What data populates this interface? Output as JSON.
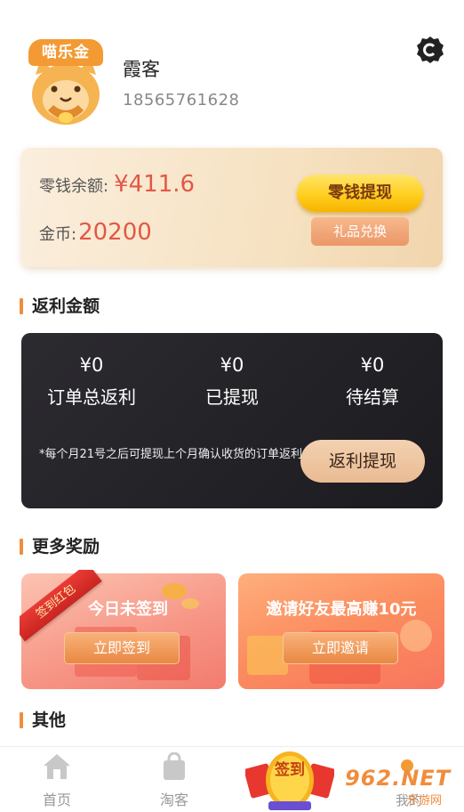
{
  "profile": {
    "avatar_logo_text": "喵乐金",
    "name": "霞客",
    "phone": "18565761628"
  },
  "wallet": {
    "balance_label": "零钱余额:",
    "balance_value": "¥411.6",
    "coin_label": "金币:",
    "coin_value": "20200",
    "withdraw_button": "零钱提现",
    "gift_button": "礼品兑换"
  },
  "rebate": {
    "section_title": "返利金额",
    "columns": [
      {
        "value": "¥0",
        "label": "订单总返利"
      },
      {
        "value": "¥0",
        "label": "已提现"
      },
      {
        "value": "¥0",
        "label": "待结算"
      }
    ],
    "note": "*每个月21号之后可提现上个月确认收货的订单返利",
    "withdraw_button": "返利提现"
  },
  "rewards": {
    "section_title": "更多奖励",
    "ribbon_text": "签到红包",
    "signin": {
      "title": "今日未签到",
      "button": "立即签到"
    },
    "invite": {
      "title": "邀请好友最高赚10元",
      "button": "立即邀请"
    }
  },
  "other": {
    "section_title": "其他"
  },
  "nav": {
    "items": [
      {
        "label": "首页"
      },
      {
        "label": "淘客"
      },
      {
        "label": "签到"
      },
      {
        "label": "我的"
      }
    ],
    "watermark_text": "962.NET",
    "watermark_sub": "乐游网"
  },
  "colors": {
    "accent_orange": "#f08d3c",
    "amount_red": "#e25845",
    "gold_button": "#ffcf1f",
    "dark_card": "#2c2b30"
  }
}
